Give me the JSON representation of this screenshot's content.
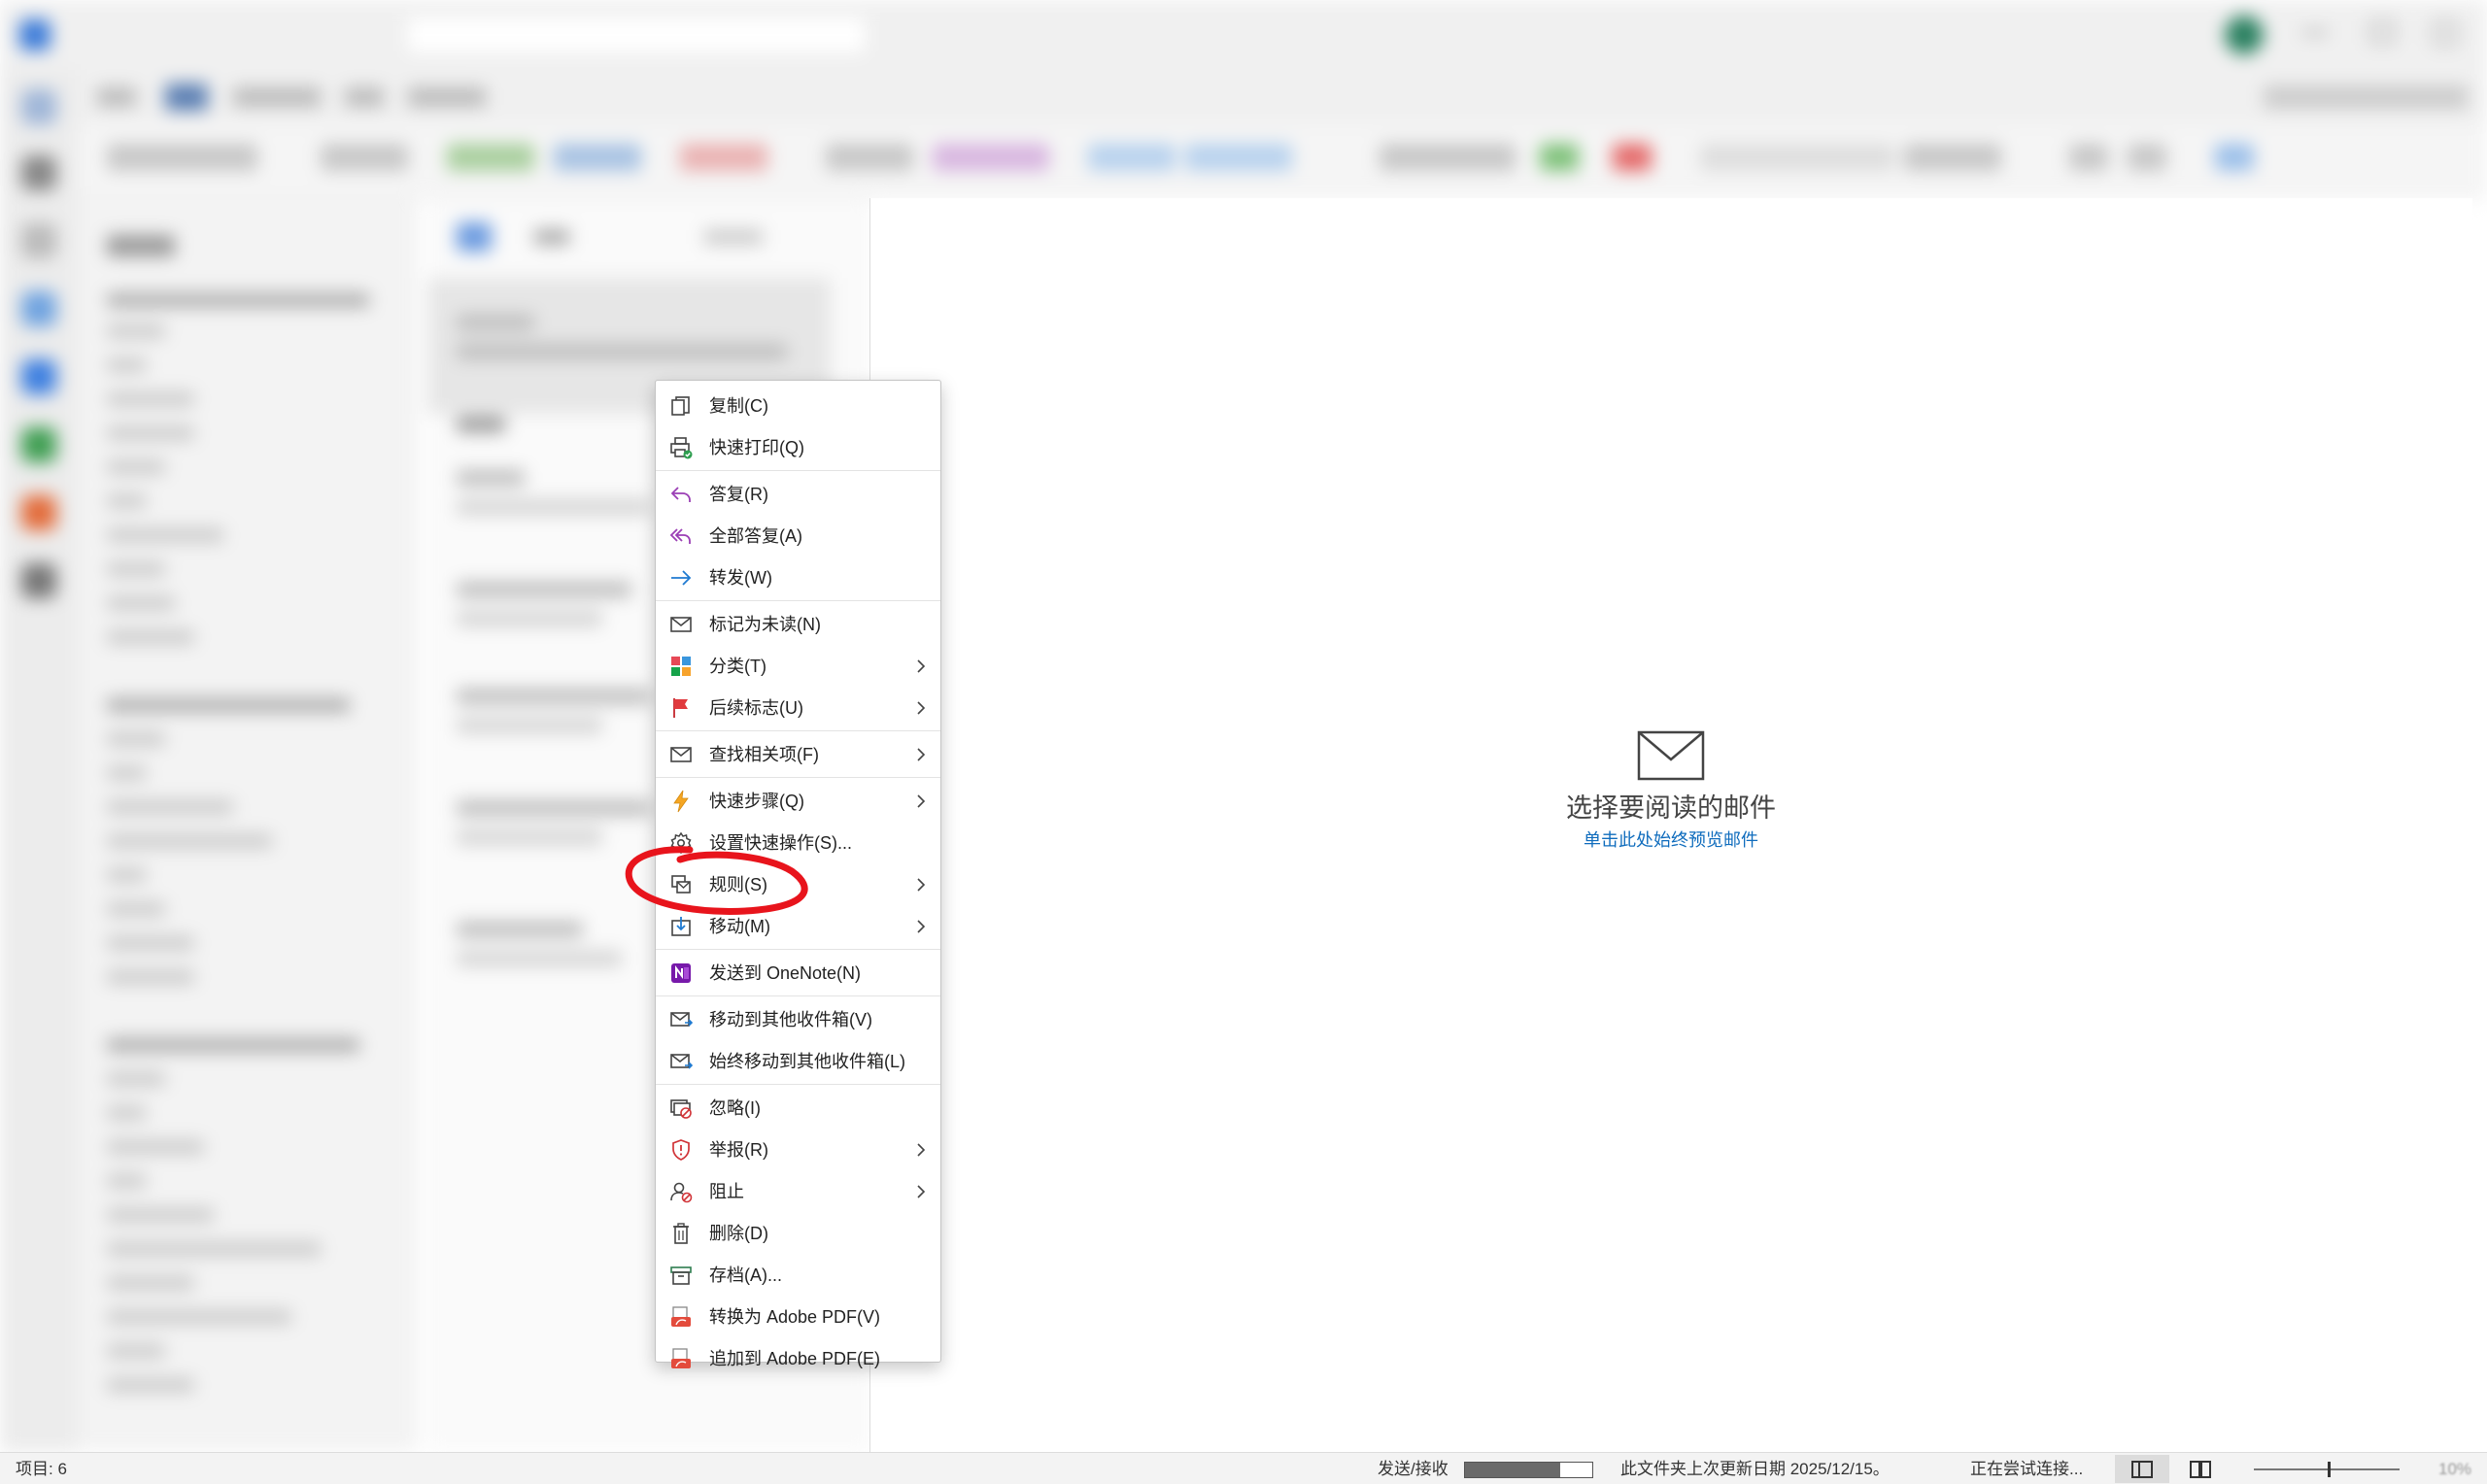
{
  "context_menu": {
    "items": [
      {
        "label": "复制(C)",
        "icon": "copy-icon"
      },
      {
        "label": "快速打印(Q)",
        "icon": "quick-print-icon"
      },
      {
        "label": "答复(R)",
        "icon": "reply-icon"
      },
      {
        "label": "全部答复(A)",
        "icon": "reply-all-icon"
      },
      {
        "label": "转发(W)",
        "icon": "forward-icon"
      },
      {
        "label": "标记为未读(N)",
        "icon": "mark-unread-icon"
      },
      {
        "label": "分类(T)",
        "icon": "categorize-icon",
        "submenu": true
      },
      {
        "label": "后续标志(U)",
        "icon": "flag-icon",
        "submenu": true
      },
      {
        "label": "查找相关项(F)",
        "icon": "find-related-icon",
        "submenu": true
      },
      {
        "label": "快速步骤(Q)",
        "icon": "lightning-icon",
        "submenu": true
      },
      {
        "label": "设置快速操作(S)...",
        "icon": "gear-icon"
      },
      {
        "label": "规则(S)",
        "icon": "rules-icon",
        "submenu": true
      },
      {
        "label": "移动(M)",
        "icon": "move-icon",
        "submenu": true
      },
      {
        "label": "发送到 OneNote(N)",
        "icon": "onenote-icon"
      },
      {
        "label": "移动到其他收件箱(V)",
        "icon": "move-to-other-icon"
      },
      {
        "label": "始终移动到其他收件箱(L)",
        "icon": "always-move-other-icon"
      },
      {
        "label": "忽略(I)",
        "icon": "ignore-icon"
      },
      {
        "label": "举报(R)",
        "icon": "report-shield-icon",
        "submenu": true
      },
      {
        "label": "阻止",
        "icon": "block-user-icon",
        "submenu": true
      },
      {
        "label": "删除(D)",
        "icon": "trash-icon"
      },
      {
        "label": "存档(A)...",
        "icon": "archive-icon"
      },
      {
        "label": "转换为 Adobe PDF(V)",
        "icon": "adobe-pdf-icon"
      },
      {
        "label": "追加到 Adobe PDF(E)",
        "icon": "adobe-pdf-append-icon"
      }
    ]
  },
  "reading_pane": {
    "empty_title": "选择要阅读的邮件",
    "empty_link": "单击此处始终预览邮件"
  },
  "status_bar": {
    "items_count": "项目: 6",
    "send_receive": "发送/接收",
    "send_receive_progress": 0.75,
    "folder_updated": "此文件夹上次更新日期 2025/12/15。",
    "connection": "正在尝试连接...",
    "zoom": "10%"
  },
  "colors": {
    "accent": "#0f6cbd",
    "annotation": "#e8141c"
  }
}
